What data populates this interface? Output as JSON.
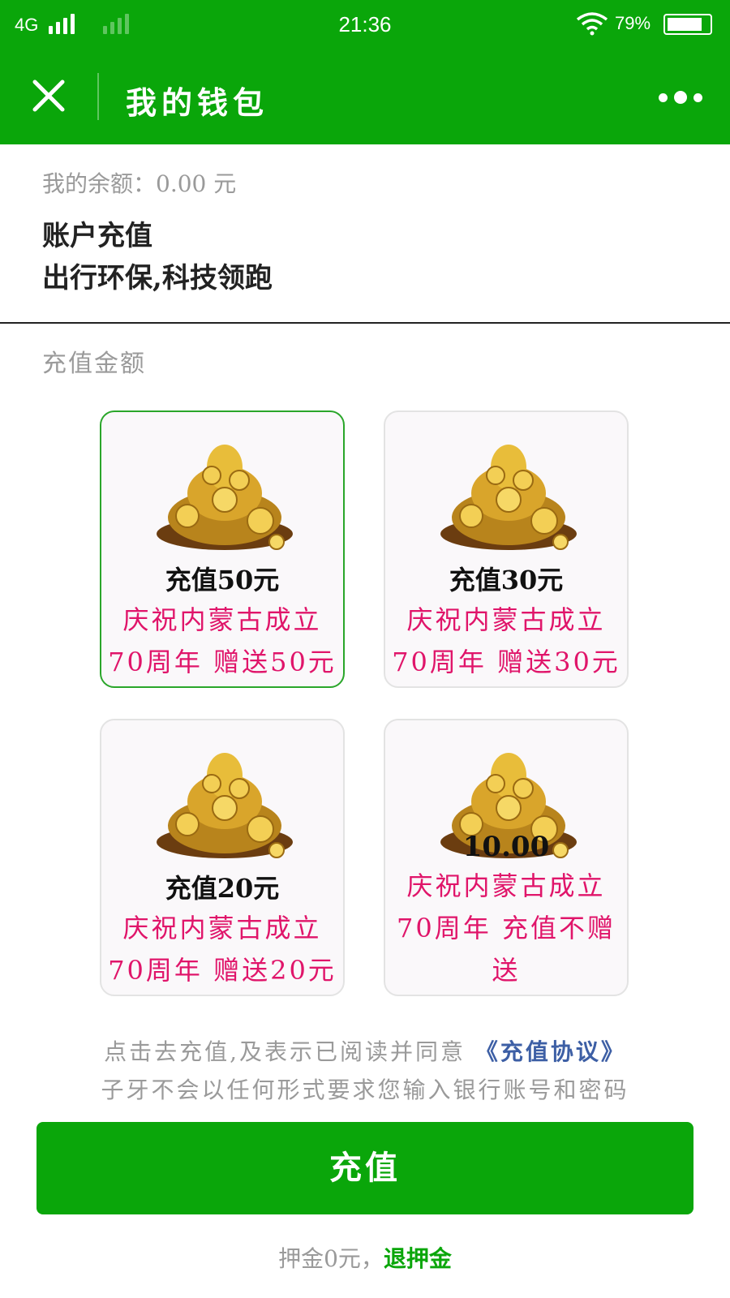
{
  "status_bar": {
    "network": "4G",
    "time": "21:36",
    "battery": "79%",
    "battery_level": 0.79
  },
  "navbar": {
    "title": "我的钱包",
    "close_icon": "close-icon",
    "more_icon": "more-dots-icon"
  },
  "account": {
    "balance": "我的余额：0.00 元",
    "recharge_title": "账户充值",
    "slogan": "出行环保,科技领跑"
  },
  "amount_label": "充值金额",
  "cards": [
    {
      "name": "充值50元",
      "promo": "庆祝内蒙古成立70周年 赠送50元",
      "selected": true
    },
    {
      "name": "充值30元",
      "promo": "庆祝内蒙古成立70周年 赠送30元",
      "selected": false
    },
    {
      "name": "充值20元",
      "promo": "庆祝内蒙古成立70周年 赠送20元",
      "selected": false
    },
    {
      "name": "10.00",
      "promo": "庆祝内蒙古成立70周年 充值不赠送",
      "selected": false
    }
  ],
  "notice": {
    "line1_prefix": "点击去充值,及表示已阅读并同意",
    "agreement_link": "《充值协议》",
    "line2": "子牙不会以任何形式要求您输入银行账号和密码"
  },
  "pay_button": "充值",
  "deposit": {
    "text": "押金0元，",
    "refund_link": "退押金"
  },
  "colors": {
    "brand_green": "#0aa60a",
    "promo_pink": "#e0156a",
    "link_blue": "#3d5fa5"
  }
}
